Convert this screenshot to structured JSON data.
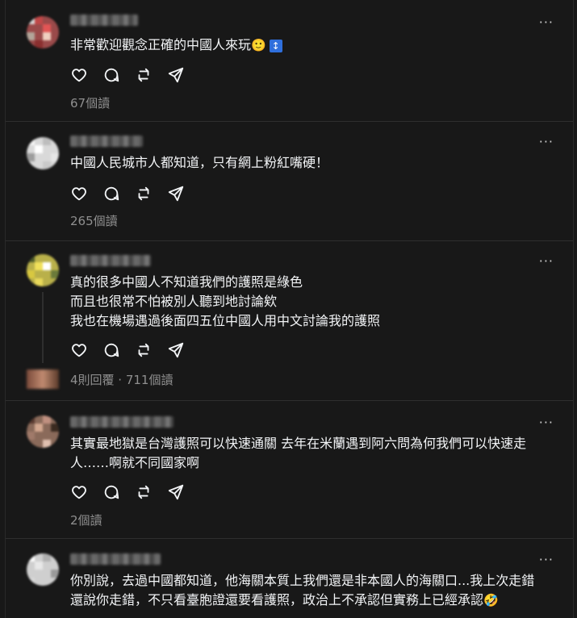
{
  "posts": [
    {
      "lines": [
        "非常歡迎觀念正確的中國人來玩"
      ],
      "emoji": "🙂",
      "badge": "↕",
      "stats": "67個讀"
    },
    {
      "lines": [
        "中國人民城市人都知道，只有網上粉紅嘴硬！"
      ],
      "stats": "265個讀"
    },
    {
      "lines": [
        "真的很多中國人不知道我們的護照是綠色",
        "而且也很常不怕被別人聽到地討論欸",
        "我也在機場遇過後面四五位中國人用中文討論我的護照"
      ],
      "stats": "4則回覆 · 711個讀"
    },
    {
      "lines": [
        "其實最地獄是台灣護照可以快速通關 去年在米蘭遇到阿六問為何我們可以快速走",
        "人……啊就不同國家啊"
      ],
      "stats": "2個讀"
    },
    {
      "lines": [
        "你別說，去過中國都知道，他海關本質上我們還是非本國人的海關口...我上次走錯",
        "還說你走錯，不只看臺胞證還要看護照，政治上不承認但實務上已經承認"
      ],
      "emoji": "🤣"
    }
  ],
  "more_label": "···",
  "icons": [
    "heart-icon",
    "comment-icon",
    "repost-icon",
    "share-icon"
  ],
  "colors": {
    "background": "#181818",
    "text": "#f3f5f7",
    "muted": "#8f8f8f",
    "divider": "#2e2e2e"
  }
}
